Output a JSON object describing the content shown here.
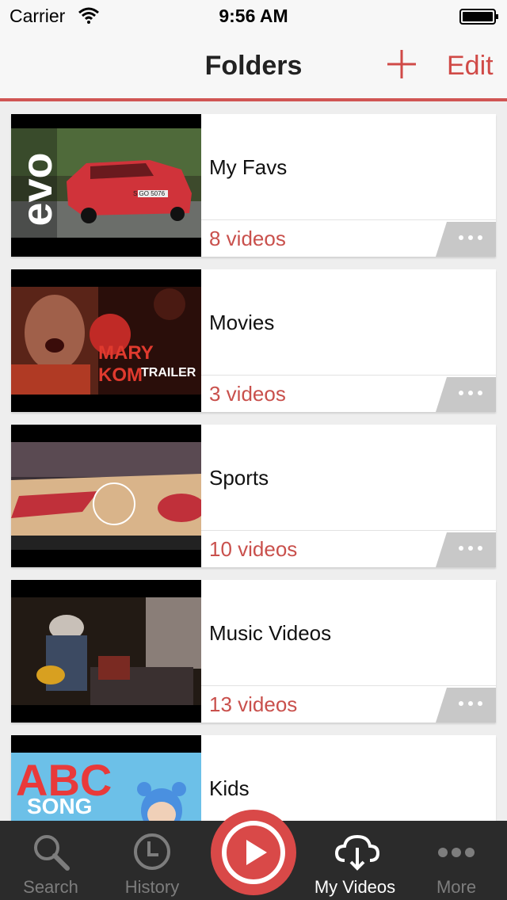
{
  "status_bar": {
    "carrier": "Carrier",
    "time": "9:56 AM"
  },
  "nav": {
    "title": "Folders",
    "edit_label": "Edit",
    "add_icon": "plus-icon"
  },
  "accent_color": "#d04a47",
  "folders": [
    {
      "name": "My Favs",
      "count": "8 videos",
      "thumb_brand": "evo",
      "thumb_plate": "S GO 5076"
    },
    {
      "name": "Movies",
      "count": "3 videos",
      "thumb_title": "MARY KOM",
      "thumb_subtitle": "TRAILER"
    },
    {
      "name": "Sports",
      "count": "10 videos"
    },
    {
      "name": "Music Videos",
      "count": "13 videos"
    },
    {
      "name": "Kids",
      "count": "",
      "thumb_title": "ABC",
      "thumb_subtitle": "SONG"
    }
  ],
  "tabs": [
    {
      "label": "Search",
      "icon": "search-icon"
    },
    {
      "label": "History",
      "icon": "clock-icon"
    },
    {
      "label": "",
      "icon": "play-icon"
    },
    {
      "label": "My Videos",
      "icon": "cloud-download-icon",
      "active": true
    },
    {
      "label": "More",
      "icon": "ellipsis-icon"
    }
  ]
}
